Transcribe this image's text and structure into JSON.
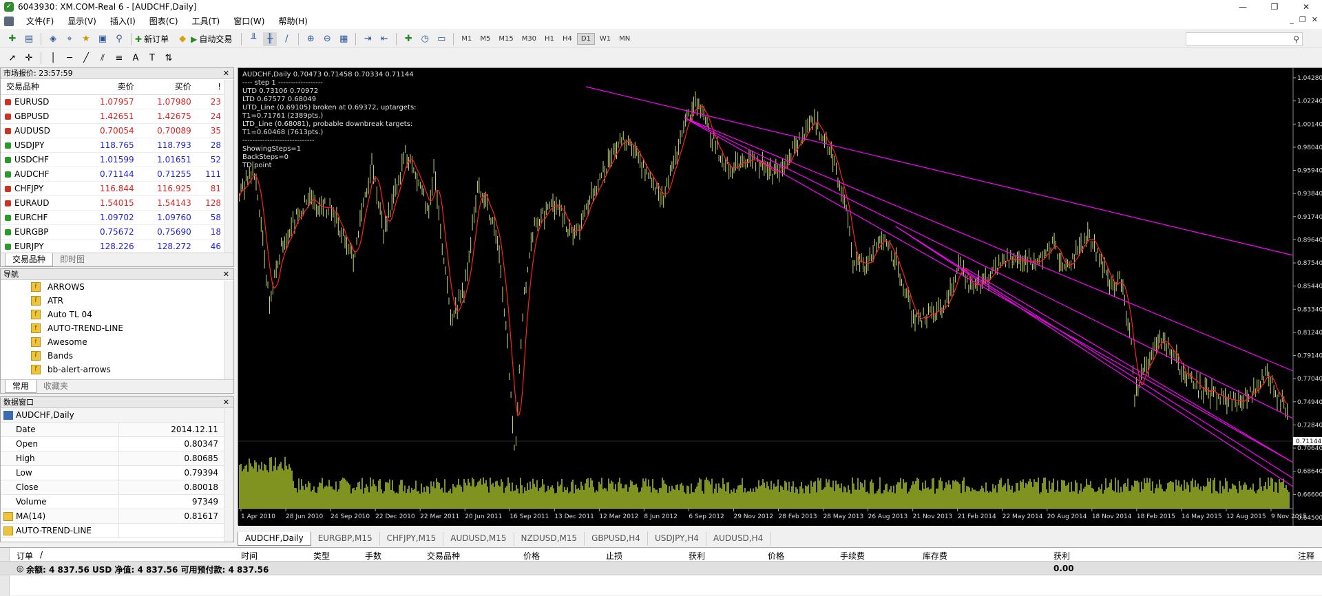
{
  "window": {
    "title": "6043930: XM.COM-Real 6 - [AUDCHF,Daily]"
  },
  "menu": [
    "文件(F)",
    "显示(V)",
    "插入(I)",
    "图表(C)",
    "工具(T)",
    "窗口(W)",
    "帮助(H)"
  ],
  "toolbar": {
    "new_order": "新订单",
    "auto_trading": "自动交易",
    "timeframes": [
      "M1",
      "M5",
      "M15",
      "M30",
      "H1",
      "H4",
      "D1",
      "W1",
      "MN"
    ],
    "active_timeframe": "D1"
  },
  "market_watch": {
    "title": "市场报价: 23:57:59",
    "columns": [
      "交易品种",
      "卖价",
      "买价",
      "!"
    ],
    "rows": [
      {
        "symbol": "EURUSD",
        "bid": "1.07957",
        "ask": "1.07980",
        "spread": "23",
        "dir": "down"
      },
      {
        "symbol": "GBPUSD",
        "bid": "1.42651",
        "ask": "1.42675",
        "spread": "24",
        "dir": "down"
      },
      {
        "symbol": "AUDUSD",
        "bid": "0.70054",
        "ask": "0.70089",
        "spread": "35",
        "dir": "down"
      },
      {
        "symbol": "USDJPY",
        "bid": "118.765",
        "ask": "118.793",
        "spread": "28",
        "dir": "up"
      },
      {
        "symbol": "USDCHF",
        "bid": "1.01599",
        "ask": "1.01651",
        "spread": "52",
        "dir": "up"
      },
      {
        "symbol": "AUDCHF",
        "bid": "0.71144",
        "ask": "0.71255",
        "spread": "111",
        "dir": "up"
      },
      {
        "symbol": "CHFJPY",
        "bid": "116.844",
        "ask": "116.925",
        "spread": "81",
        "dir": "down"
      },
      {
        "symbol": "EURAUD",
        "bid": "1.54015",
        "ask": "1.54143",
        "spread": "128",
        "dir": "down"
      },
      {
        "symbol": "EURCHF",
        "bid": "1.09702",
        "ask": "1.09760",
        "spread": "58",
        "dir": "up"
      },
      {
        "symbol": "EURGBP",
        "bid": "0.75672",
        "ask": "0.75690",
        "spread": "18",
        "dir": "up"
      },
      {
        "symbol": "EURJPY",
        "bid": "128.226",
        "ask": "128.272",
        "spread": "46",
        "dir": "up"
      }
    ],
    "tabs": [
      "交易品种",
      "即时图"
    ]
  },
  "navigator": {
    "title": "导航",
    "items": [
      "ARROWS",
      "ATR",
      "Auto TL 04",
      "AUTO-TREND-LINE",
      "Awesome",
      "Bands",
      "bb-alert-arrows"
    ],
    "tabs": [
      "常用",
      "收藏夹"
    ]
  },
  "data_window": {
    "title": "数据窗口",
    "symbol": "AUDCHF,Daily",
    "rows": [
      {
        "k": "Date",
        "v": "2014.12.11"
      },
      {
        "k": "Open",
        "v": "0.80347"
      },
      {
        "k": "High",
        "v": "0.80685"
      },
      {
        "k": "Low",
        "v": "0.79394"
      },
      {
        "k": "Close",
        "v": "0.80018"
      },
      {
        "k": "Volume",
        "v": "97349"
      },
      {
        "k": "MA(14)",
        "v": "0.81617"
      },
      {
        "k": "AUTO-TREND-LINE",
        "v": ""
      }
    ]
  },
  "chart": {
    "header": "AUDCHF,Daily  0.70473 0.71458 0.70334 0.71144",
    "info_lines": [
      "---- step 1 ------------------",
      "UTD 0.73106  0.70972",
      "LTD  0.67577  0.68049",
      "UTD_Line (0.69105) broken at 0.69372, uptargets:",
      "T1=0.71761 (2389pts.)",
      "LTD_Line (0.68081), probable downbreak targets:",
      "T1=0.60468 (7613pts.)",
      "-----------------------------",
      "ShowingSteps=1",
      "BackSteps=0",
      "TD point"
    ],
    "current_price": "0.71144",
    "price_labels": [
      "1.04280",
      "1.02240",
      "1.00140",
      "0.98040",
      "0.95940",
      "0.93840",
      "0.91740",
      "0.89640",
      "0.87540",
      "0.85440",
      "0.83340",
      "0.81240",
      "0.79140",
      "0.77040",
      "0.74940",
      "0.72840",
      "0.70640",
      "0.68640",
      "0.66600",
      "0.64500"
    ],
    "date_labels": [
      "1 Apr 2010",
      "28 Jun 2010",
      "24 Sep 2010",
      "22 Dec 2010",
      "22 Mar 2011",
      "20 Jun 2011",
      "16 Sep 2011",
      "13 Dec 2011",
      "12 Mar 2012",
      "8 Jun 2012",
      "6 Sep 2012",
      "29 Nov 2012",
      "28 Feb 2013",
      "28 May 2013",
      "26 Aug 2013",
      "21 Nov 2013",
      "21 Feb 2014",
      "22 May 2014",
      "20 Aug 2014",
      "18 Nov 2014",
      "18 Feb 2015",
      "14 May 2015",
      "12 Aug 2015",
      "9 Nov 2015"
    ],
    "colors": {
      "bg": "#000000",
      "candles": "#c8d86a",
      "ma": "#ff2020",
      "trendline": "#ff00ff",
      "volume": "#a0b828",
      "grid": "#2a2a2a"
    }
  },
  "chart_tabs": [
    "AUDCHF,Daily",
    "EURGBP,M15",
    "CHFJPY,M15",
    "AUDUSD,M15",
    "NZDUSD,M15",
    "GBPUSD,H4",
    "USDJPY,H4",
    "AUDUSD,H4"
  ],
  "terminal": {
    "columns": [
      "订单",
      "/",
      "时间",
      "类型",
      "手数",
      "交易品种",
      "价格",
      "止损",
      "获利",
      "价格",
      "手续费",
      "库存费",
      "获利",
      "注释"
    ],
    "balance": "余额: 4 837.56 USD  净值: 4 837.56  可用预付款: 4 837.56",
    "profit": "0.00"
  }
}
